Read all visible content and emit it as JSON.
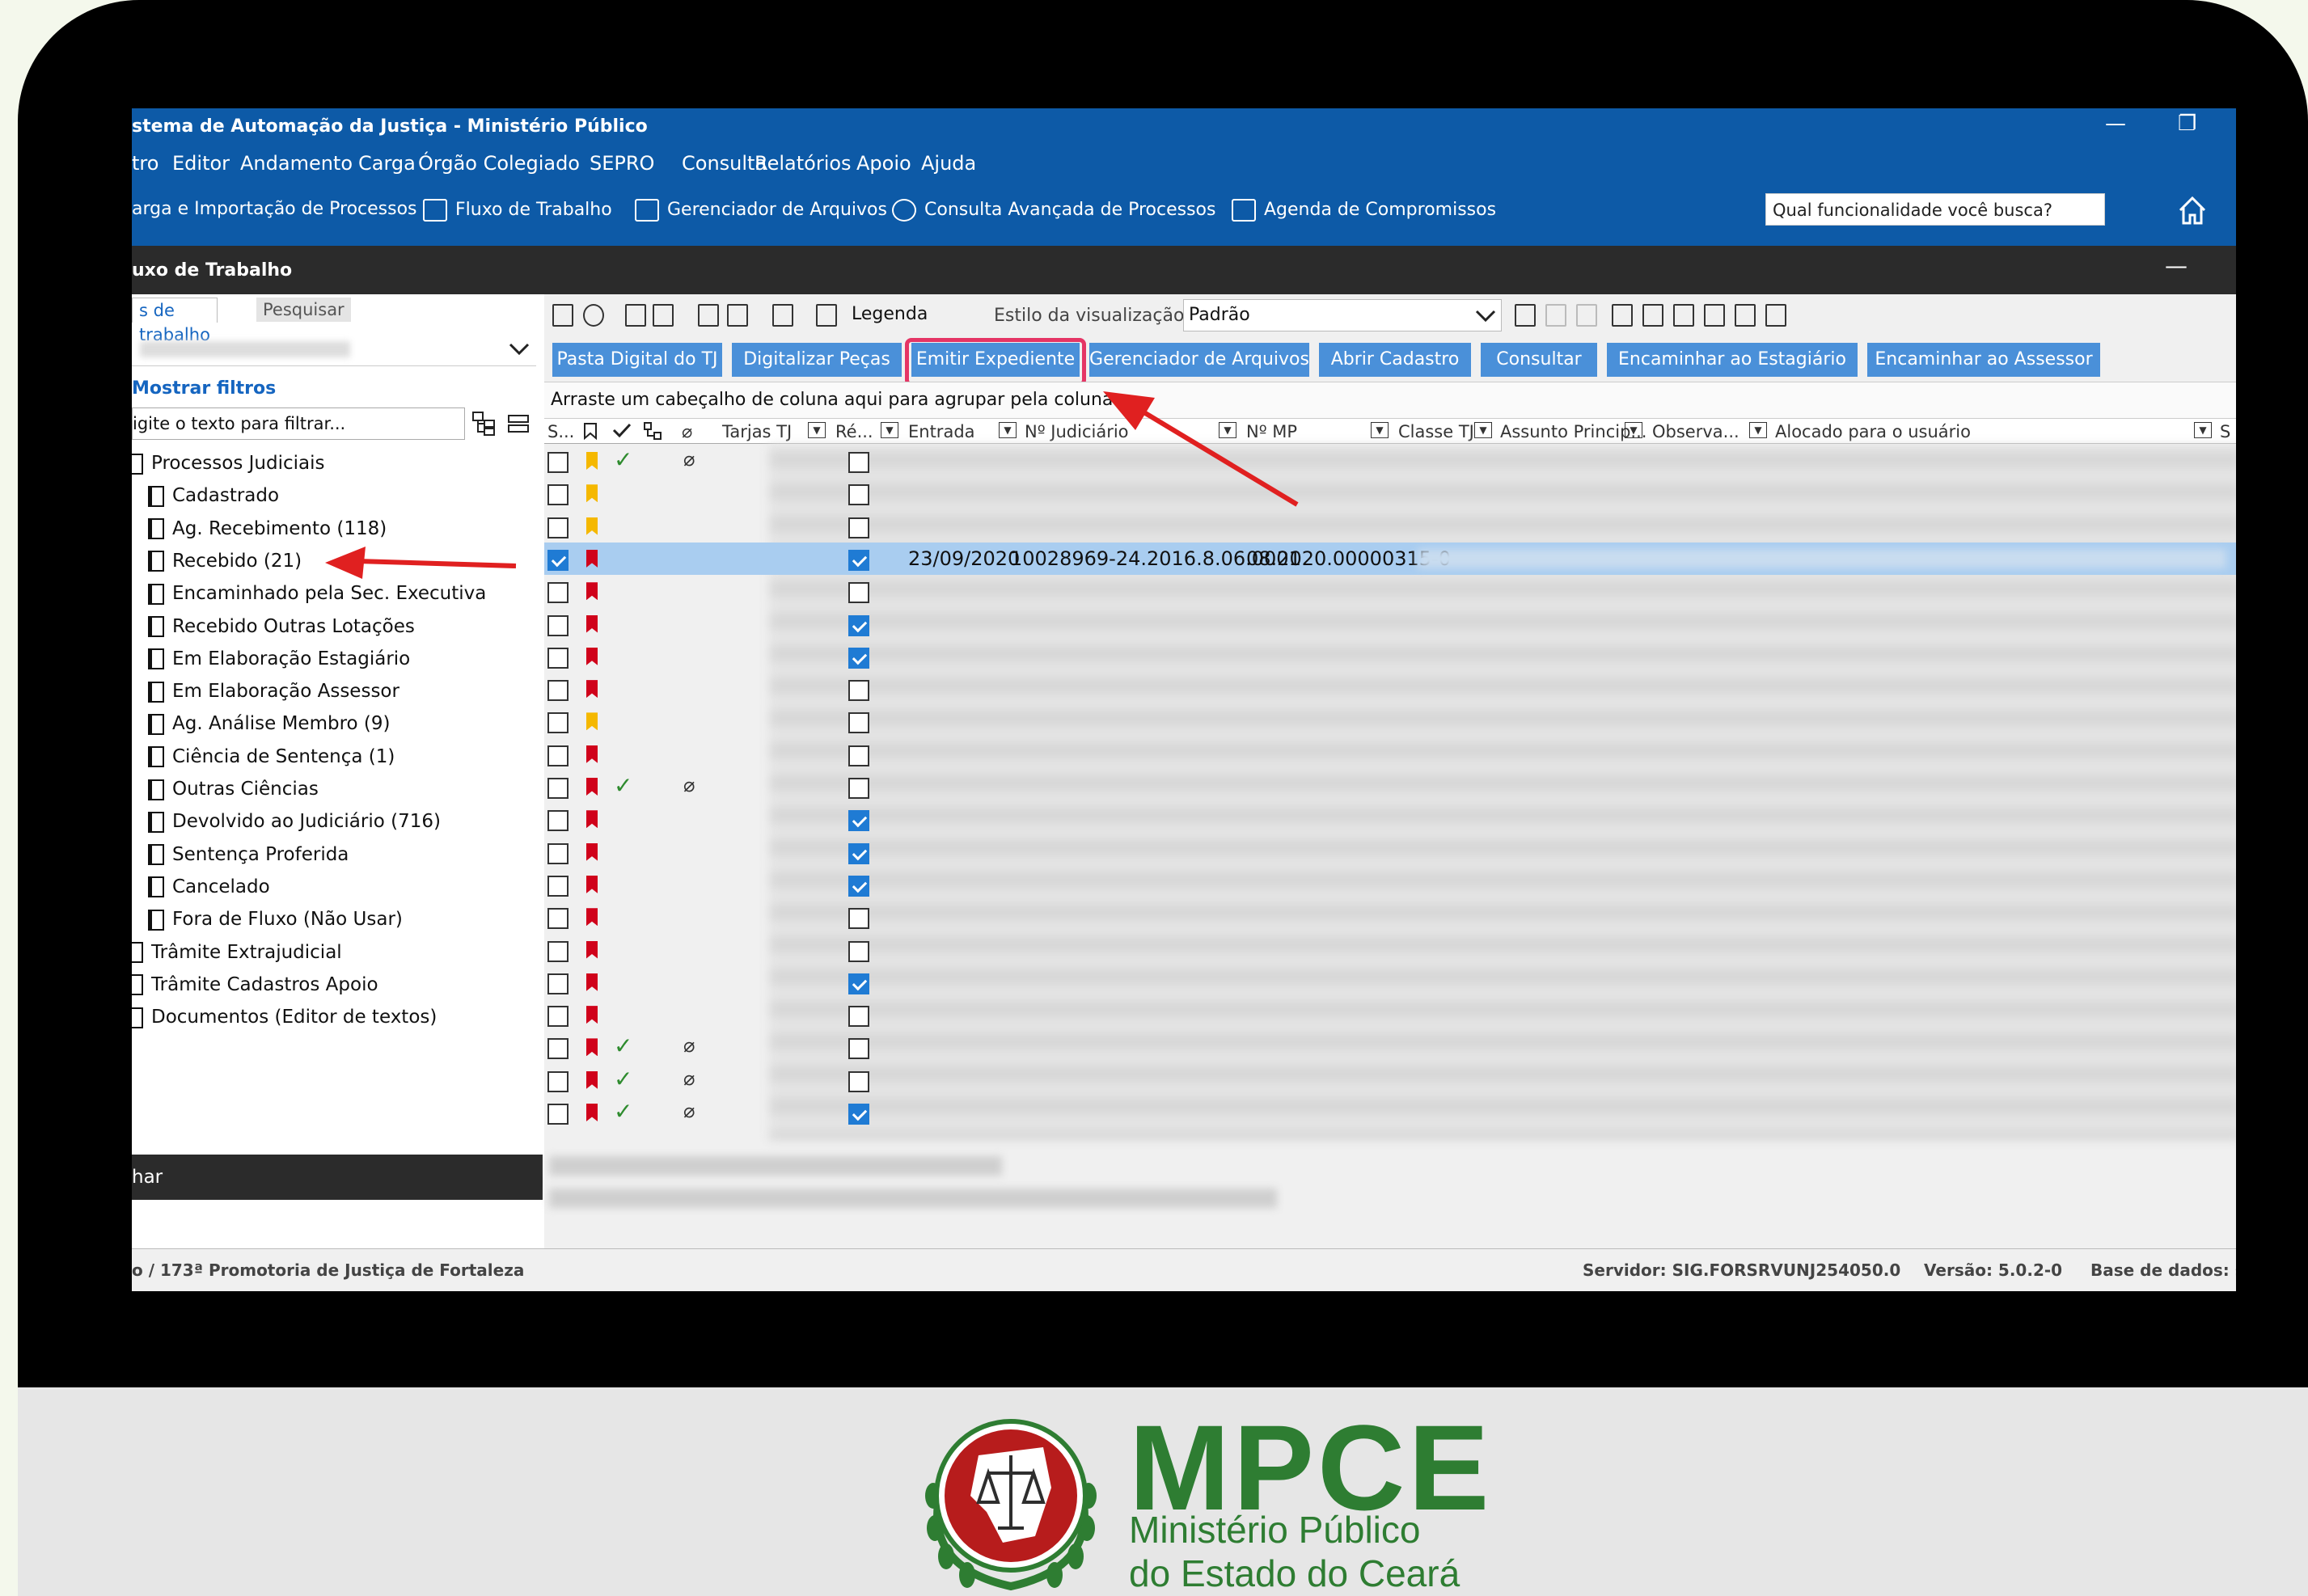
{
  "window": {
    "title": "stema de Automação da Justiça - Ministério Público",
    "min_glyph": "—",
    "restore_glyph": "❐"
  },
  "menu": [
    "tro",
    "Editor",
    "Andamento",
    "Carga",
    "Órgão Colegiado",
    "SEPRO",
    "Consulta",
    "Relatórios",
    "Apoio",
    "Ajuda"
  ],
  "toolbar": {
    "items": [
      {
        "label": "arga e Importação de Processos",
        "icon": "import-icon"
      },
      {
        "label": "Fluxo de Trabalho",
        "icon": "workflow-icon"
      },
      {
        "label": "Gerenciador de Arquivos",
        "icon": "file-manager-icon"
      },
      {
        "label": "Consulta Avançada de Processos",
        "icon": "advanced-search-icon"
      },
      {
        "label": "Agenda de Compromissos",
        "icon": "calendar-icon"
      }
    ],
    "search_placeholder": "Qual funcionalidade você busca?"
  },
  "panel": {
    "title": "uxo de Trabalho",
    "min_glyph": "—"
  },
  "left": {
    "tabs": [
      "s de trabalho",
      "Pesquisar"
    ],
    "show_filters": "Mostrar filtros",
    "filter_placeholder": "igite o texto para filtrar...",
    "tree": [
      {
        "label": "Processos Judiciais",
        "level": 0
      },
      {
        "label": "Cadastrado",
        "level": 1
      },
      {
        "label": "Ag. Recebimento (118)",
        "level": 1
      },
      {
        "label": "Recebido (21)",
        "level": 1
      },
      {
        "label": "Encaminhado pela Sec. Executiva",
        "level": 1
      },
      {
        "label": "Recebido Outras Lotações",
        "level": 1
      },
      {
        "label": "Em Elaboração Estagiário",
        "level": 1
      },
      {
        "label": "Em Elaboração Assessor",
        "level": 1
      },
      {
        "label": "Ag. Análise Membro (9)",
        "level": 1
      },
      {
        "label": "Ciência de Sentença (1)",
        "level": 1
      },
      {
        "label": "Outras Ciências",
        "level": 1
      },
      {
        "label": "Devolvido ao Judiciário (716)",
        "level": 1
      },
      {
        "label": "Sentença Proferida",
        "level": 1
      },
      {
        "label": "Cancelado",
        "level": 1
      },
      {
        "label": "Fora de Fluxo (Não Usar)",
        "level": 1
      },
      {
        "label": "Trâmite Extrajudicial",
        "level": 0
      },
      {
        "label": "Trâmite Cadastros Apoio",
        "level": 0
      },
      {
        "label": "Documentos (Editor de textos)",
        "level": 0
      }
    ],
    "bottom_label": "har"
  },
  "right": {
    "legend_label": "Legenda",
    "view_style_label": "Estilo da visualização",
    "view_style_value": "Padrão",
    "buttons": [
      "Pasta Digital do TJ",
      "Digitalizar Peças",
      "Emitir Expediente",
      "Gerenciador de Arquivos",
      "Abrir Cadastro",
      "Consultar",
      "Encaminhar ao Estagiário",
      "Encaminhar ao Assessor"
    ],
    "group_hint": "Arraste um cabeçalho de coluna aqui para agrupar pela coluna",
    "columns": [
      "S...",
      "Tarjas TJ",
      "Ré...",
      "Entrada",
      "Nº Judiciário",
      "Nº MP",
      "Classe TJ",
      "Assunto Princip...",
      "Observa...",
      "Alocado para o usuário",
      "S"
    ],
    "rows": [
      {
        "checked": false,
        "flag": "#f5b800",
        "ok": true,
        "clip": true,
        "re": false
      },
      {
        "checked": false,
        "flag": "#f5b800",
        "ok": false,
        "clip": false,
        "re": false
      },
      {
        "checked": false,
        "flag": "#f5b800",
        "ok": false,
        "clip": false,
        "re": false
      },
      {
        "checked": true,
        "flag": "#d0021b",
        "ok": false,
        "clip": false,
        "re": true,
        "selected": true,
        "entrada": "23/09/2020",
        "judiciario": "10028969-24.2016.8.06.0001",
        "mp": "08.2020.00000315-0"
      },
      {
        "checked": false,
        "flag": "#d0021b",
        "ok": false,
        "clip": false,
        "re": false
      },
      {
        "checked": false,
        "flag": "#d0021b",
        "ok": false,
        "clip": false,
        "re": true
      },
      {
        "checked": false,
        "flag": "#d0021b",
        "ok": false,
        "clip": false,
        "re": true
      },
      {
        "checked": false,
        "flag": "#d0021b",
        "ok": false,
        "clip": false,
        "re": false
      },
      {
        "checked": false,
        "flag": "#f5b800",
        "ok": false,
        "clip": false,
        "re": false
      },
      {
        "checked": false,
        "flag": "#d0021b",
        "ok": false,
        "clip": false,
        "re": false
      },
      {
        "checked": false,
        "flag": "#d0021b",
        "ok": true,
        "clip": true,
        "re": false
      },
      {
        "checked": false,
        "flag": "#d0021b",
        "ok": false,
        "clip": false,
        "re": true
      },
      {
        "checked": false,
        "flag": "#d0021b",
        "ok": false,
        "clip": false,
        "re": true
      },
      {
        "checked": false,
        "flag": "#d0021b",
        "ok": false,
        "clip": false,
        "re": true
      },
      {
        "checked": false,
        "flag": "#d0021b",
        "ok": false,
        "clip": false,
        "re": false
      },
      {
        "checked": false,
        "flag": "#d0021b",
        "ok": false,
        "clip": false,
        "re": false
      },
      {
        "checked": false,
        "flag": "#d0021b",
        "ok": false,
        "clip": false,
        "re": true
      },
      {
        "checked": false,
        "flag": "#d0021b",
        "ok": false,
        "clip": false,
        "re": false
      },
      {
        "checked": false,
        "flag": "#d0021b",
        "ok": true,
        "clip": true,
        "re": false
      },
      {
        "checked": false,
        "flag": "#d0021b",
        "ok": true,
        "clip": true,
        "re": false
      },
      {
        "checked": false,
        "flag": "#d0021b",
        "ok": true,
        "clip": true,
        "re": true
      }
    ]
  },
  "status": {
    "left": "o / 173ª Promotoria de Justiça de Fortaleza",
    "server": "Servidor: SIG.FORSRVUNJ254050.0",
    "version": "Versão: 5.0.2-0",
    "db": "Base de dados: s"
  },
  "brand": {
    "name": "MPCE",
    "line1": "Ministério Público",
    "line2": "do Estado do Ceará",
    "green": "#2e7d32",
    "red": "#b71c1c"
  },
  "colors": {
    "accent": "#0d5aa7",
    "button": "#4a90d9",
    "highlight": "#e53565",
    "arrow": "#e02020"
  }
}
